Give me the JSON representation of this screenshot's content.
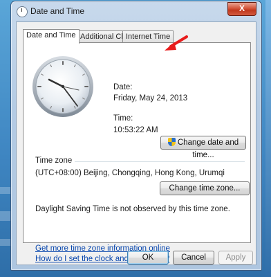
{
  "window": {
    "title": "Date and Time",
    "close_label": "X"
  },
  "tabs": [
    {
      "label": "Date and Time",
      "active": true
    },
    {
      "label": "Additional Clocks",
      "active": false
    },
    {
      "label": "Internet Time",
      "active": false
    }
  ],
  "date_time": {
    "date_label": "Date:",
    "date_value": "Friday, May 24, 2013",
    "time_label": "Time:",
    "time_value": "10:53:22 AM",
    "change_button": "Change date and time..."
  },
  "time_zone": {
    "heading": "Time zone",
    "value": "(UTC+08:00) Beijing, Chongqing, Hong Kong, Urumqi",
    "change_button": "Change time zone...",
    "dst_note": "Daylight Saving Time is not observed by this time zone."
  },
  "links": {
    "more_info": "Get more time zone information online",
    "how_to": "How do I set the clock and time zone?"
  },
  "footer": {
    "ok": "OK",
    "cancel": "Cancel",
    "apply": "Apply"
  },
  "colors": {
    "link": "#0645ad",
    "annotation_arrow": "#e81c1c",
    "close_button": "#c8432a"
  }
}
